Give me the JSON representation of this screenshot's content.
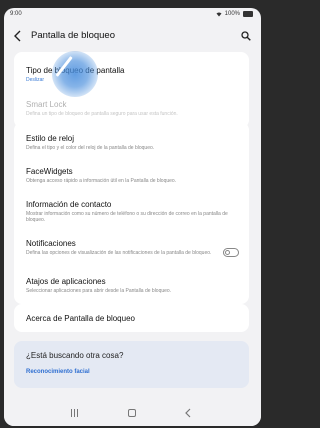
{
  "status": {
    "time": "9:00",
    "battery": "100%"
  },
  "header": {
    "title": "Pantalla de bloqueo"
  },
  "card1": {
    "items": [
      {
        "title": "Tipo de bloqueo de pantalla",
        "subtitle": "Deslizar"
      },
      {
        "title": "Smart Lock",
        "subtitle": "Defina un tipo de bloqueo de pantalla seguro para usar esta función."
      }
    ]
  },
  "card2": {
    "items": [
      {
        "title": "Estilo de reloj",
        "subtitle": "Defina el tipo y el color del reloj de la pantalla de bloqueo."
      },
      {
        "title": "FaceWidgets",
        "subtitle": "Obtenga acceso rápido a información útil en la Pantalla de bloqueo."
      },
      {
        "title": "Información de contacto",
        "subtitle": "Mostrar información como su número de teléfono o su dirección de correo en la pantalla de bloqueo."
      },
      {
        "title": "Notificaciones",
        "subtitle": "Defina las opciones de visualización de las notificaciones de la pantalla de bloqueo.",
        "toggle": false
      },
      {
        "title": "Atajos de aplicaciones",
        "subtitle": "Seleccionar aplicaciones para abrir desde la Pantalla de bloqueo."
      }
    ]
  },
  "card3": {
    "title": "Acerca de Pantalla de bloqueo"
  },
  "suggest": {
    "heading": "¿Está buscando otra cosa?",
    "link": "Reconocimiento facial"
  },
  "icons": {
    "back": "arrow-left-icon",
    "search": "search-icon",
    "recents": "recents-icon",
    "home": "home-icon",
    "navback": "chevron-left-icon"
  }
}
